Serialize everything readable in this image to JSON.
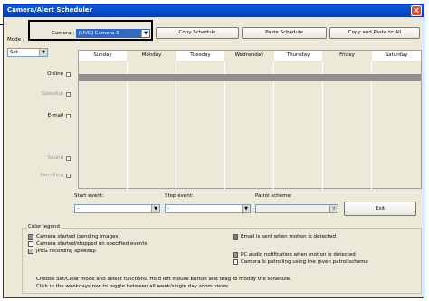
{
  "window": {
    "title": "Camera/Alert Scheduler",
    "close": "×"
  },
  "toolbar": {
    "camera_label": "Camera :",
    "camera_value": "[UVC] Camera 3",
    "copy_schedule": "Copy Schedule",
    "paste_schedule": "Paste Schedule",
    "copy_paste_all": "Copy and Paste to All"
  },
  "mode": {
    "label": "Mode :",
    "value": "Set"
  },
  "days": [
    "Sunday",
    "Monday",
    "Tuesday",
    "Wednesday",
    "Thursday",
    "Friday",
    "Saturday"
  ],
  "rows": {
    "online": "Online",
    "speedup": "Speedup",
    "email": "E-mail",
    "sound": "Sound",
    "patrolling": "Patrolling"
  },
  "events": {
    "start_label": "Start event:",
    "start_value": "-",
    "stop_label": "Stop event:",
    "stop_value": "-",
    "patrol_label": "Patrol scheme:",
    "patrol_value": "",
    "exit": "Exit"
  },
  "legend": {
    "title": "Color legend",
    "items": [
      "Camera started (sending images)",
      "Camera started/stopped on specified events",
      "JPEG recording speedup",
      "Email is sent when motion is detected",
      "PC audio notification when motion is detected",
      "Camera is patrolling using the given patrol scheme"
    ],
    "colors": [
      "#8f8f8f",
      "#ffffff",
      "#bdbdbd",
      "#7a7a7a",
      "#999999",
      "#ffffff"
    ]
  },
  "help": {
    "line1": "Choose Set/Clear mode and select functions. Hold left mouse button and drag to modify the schedule.",
    "line2": "Click in the weekdays row to toggle between all week/single day zoom views."
  }
}
